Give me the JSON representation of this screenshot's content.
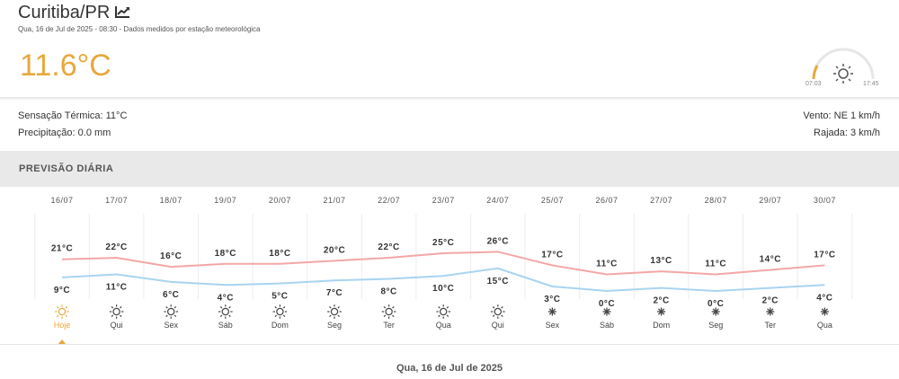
{
  "location": {
    "city": "Curitiba/PR",
    "icon": "trend-chart-icon"
  },
  "datetime": "Qua, 16 de Jul de 2025 - 08:30 - Dados medidos por estação meteorológica",
  "current": {
    "temp": "11.6°C",
    "temp_color": "#e8a83c"
  },
  "sun": {
    "sunrise": "07:03",
    "sunset": "17:45",
    "icon": "sun-icon"
  },
  "details": {
    "feels_like": "Sensação Térmica: 11°C",
    "precipitation": "Precipitação: 0.0 mm",
    "wind": "Vento: NE 1 km/h",
    "gust": "Rajada: 3 km/h"
  },
  "forecast_title": "PREVISÃO DIÁRIA",
  "chart_data": {
    "type": "line",
    "categories": [
      "16/07",
      "17/07",
      "18/07",
      "19/07",
      "20/07",
      "21/07",
      "22/07",
      "23/07",
      "24/07",
      "25/07",
      "26/07",
      "27/07",
      "28/07",
      "29/07",
      "30/07"
    ],
    "weekdays": [
      "Hoje",
      "Qui",
      "Sex",
      "Sáb",
      "Dom",
      "Seg",
      "Ter",
      "Qua",
      "Qui",
      "Sex",
      "Sáb",
      "Dom",
      "Seg",
      "Ter",
      "Qua"
    ],
    "series": [
      {
        "color": "#f4a6a6",
        "values": [
          21,
          22,
          16,
          18,
          18,
          20,
          22,
          25,
          26,
          17,
          11,
          13,
          11,
          14,
          17
        ]
      },
      {
        "color": "#a8d4f0",
        "values": [
          9,
          11,
          6,
          4,
          5,
          7,
          8,
          10,
          15,
          3,
          0,
          2,
          0,
          2,
          4
        ]
      }
    ],
    "icons": [
      "sun-icon",
      "sun-icon",
      "sun-icon",
      "sun-icon",
      "sun-icon",
      "sun-icon",
      "sun-icon",
      "sun-icon",
      "sun-icon",
      "moon-star-icon",
      "moon-star-icon",
      "moon-star-icon",
      "moon-star-icon",
      "moon-star-icon",
      "moon-star-icon"
    ],
    "unit": "°C",
    "selected_index": 0,
    "highlight_color": "#e8a83c"
  },
  "footer_date": "Qua, 16 de Jul de 2025"
}
